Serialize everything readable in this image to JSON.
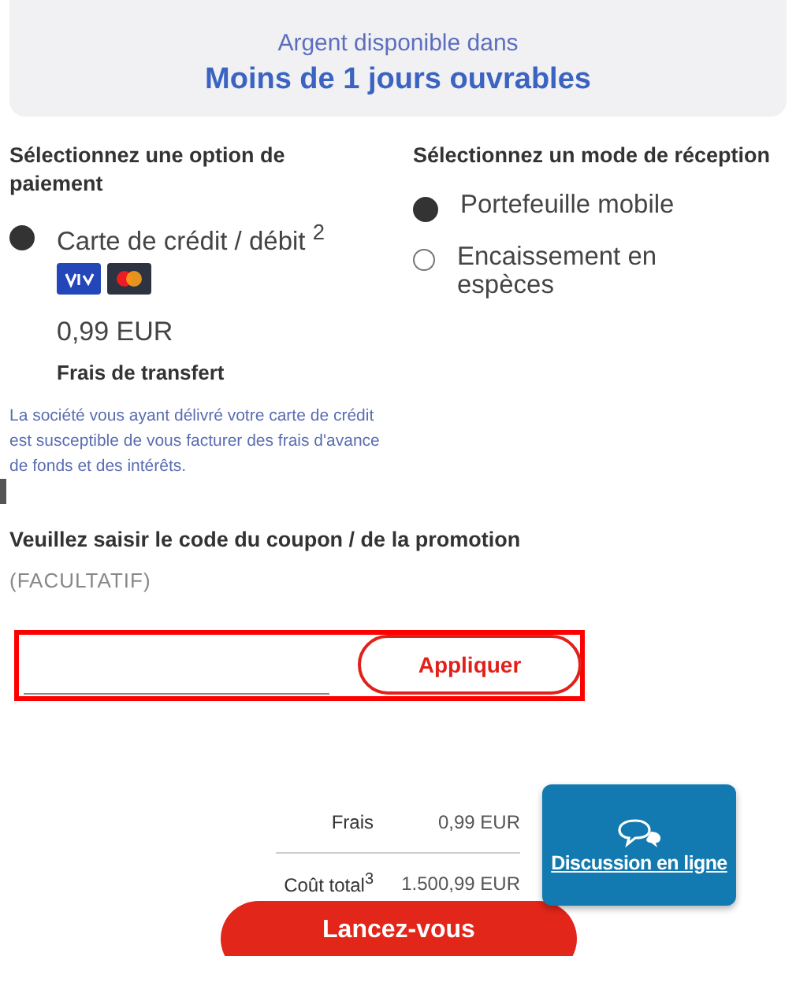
{
  "availability": {
    "label": "Argent disponible dans",
    "value": "Moins de 1 jours ouvrables"
  },
  "payment": {
    "heading": "Sélectionnez une option de paiement",
    "options": [
      {
        "label": "Carte de crédit / débit $^{2}$",
        "selected": true,
        "fee": "0,99 EUR",
        "fee_label": "Frais de transfert"
      }
    ],
    "note": "La société vous ayant délivré votre carte de crédit est susceptible de vous facturer des frais d'avance de fonds et des intérêts."
  },
  "delivery": {
    "heading": "Sélectionnez un mode de réception",
    "options": [
      {
        "label": "Portefeuille mobile",
        "selected": true
      },
      {
        "label": "Encaissement en espèces",
        "selected": false
      }
    ]
  },
  "coupon": {
    "heading": "Veuillez saisir le code du coupon / de la promotion",
    "hint": "(FACULTATIF)",
    "button": "Appliquer"
  },
  "summary": [
    {
      "label": "Frais",
      "value": "0,99 EUR"
    },
    {
      "label": "Coût total$^{3}$",
      "value": "1.500,99 EUR"
    }
  ],
  "chat": {
    "label": "Discussion en ligne"
  },
  "submit": "Lancez-vous"
}
